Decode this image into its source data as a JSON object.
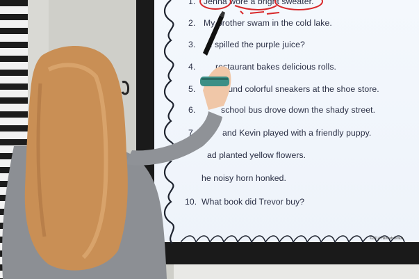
{
  "worksheet": {
    "lines": [
      {
        "num": "1.",
        "text": "Jenna wore a bright sweater."
      },
      {
        "num": "2.",
        "text": "My brother swam in the cold lake."
      },
      {
        "num": "3.",
        "text": "I spilled the purple juice?"
      },
      {
        "num": "4.",
        "text": "restaurant bakes delicious rolls."
      },
      {
        "num": "5.",
        "text": "found colorful sneakers at the shoe store."
      },
      {
        "num": "6.",
        "text": "school bus drove down the shady street."
      },
      {
        "num": "7.",
        "text": "and Kevin played with a friendly puppy."
      },
      {
        "num": "",
        "text": "ad planted yellow  flowers."
      },
      {
        "num": "",
        "text": "he noisy horn honked."
      },
      {
        "num": "10.",
        "text": "What book did Trevor buy?"
      }
    ],
    "copyright": "©2014 Hannah Braun"
  },
  "colors": {
    "screen": "#f4f8fd",
    "text": "#2a2f45",
    "annotation": "#d8282a",
    "sweater": "#8c8f94",
    "hair": "#c98f55",
    "bezel": "#1a1a1a"
  }
}
